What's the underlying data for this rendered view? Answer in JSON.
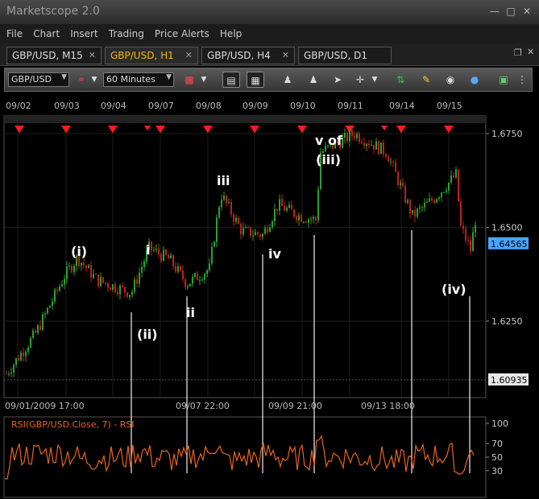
{
  "window": {
    "title": "Marketscope 2.0"
  },
  "menu": [
    "File",
    "Chart",
    "Insert",
    "Trading",
    "Price Alerts",
    "Help"
  ],
  "tabs": [
    {
      "label": "GBP/USD, M15",
      "active": false
    },
    {
      "label": "GBP/USD, H1",
      "active": true
    },
    {
      "label": "GBP/USD, H4",
      "active": false
    },
    {
      "label": "GBP/USD, D1",
      "active": false
    }
  ],
  "toolbar": {
    "symbol": "GBP/USD",
    "timeframe": "60 Minutes"
  },
  "chart": {
    "top_dates": [
      "09/02",
      "09/03",
      "09/04",
      "09/07",
      "09/08",
      "09/09",
      "09/10",
      "09/11",
      "09/14",
      "09/15"
    ],
    "bottom_dates": [
      "09/01/2009 17:00",
      "09/07 22:00",
      "09/09 21:00",
      "09/13 18:00"
    ],
    "price_ticks": [
      "1.6750",
      "1.6500",
      "1.6250"
    ],
    "current_price": "1.64565",
    "low_price": "1.60935",
    "wave_labels": [
      "(i)",
      "(ii)",
      "i",
      "ii",
      "iii",
      "iv",
      "v of",
      "(iii)",
      "(iv)"
    ],
    "rsi_title": "RSI(GBP/USD.Close, 7) - RSI",
    "rsi_ticks": [
      "100",
      "70",
      "50",
      "30"
    ],
    "colors": {
      "up": "#2ea02e",
      "down": "#c02020",
      "rsi": "#e8641e",
      "marker": "#ff1a1a",
      "price_tag": "#4aa3ff"
    }
  }
}
